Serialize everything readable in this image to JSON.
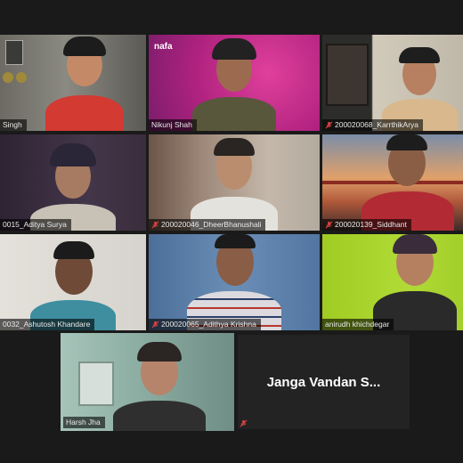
{
  "meeting": {
    "participants": [
      {
        "id": "p1",
        "label": "Singh",
        "muted": false,
        "bg": "#6f6d66",
        "shirt": "#d23a32",
        "skin": "#c48a67",
        "hat": "#1c1c1c"
      },
      {
        "id": "p2",
        "label": "Nikunj Shah",
        "muted": false,
        "bg": "#c0288f",
        "shirt": "#58573b",
        "skin": "#9c6b4f",
        "hat": "#222222"
      },
      {
        "id": "p3",
        "label": "200020068_KarrthikArya",
        "muted": true,
        "bg": "#c9c2b3",
        "shirt": "#d8b88c",
        "skin": "#b78060",
        "hat": "#1e1e1e"
      },
      {
        "id": "p4",
        "label": "0015_Aditya Surya",
        "muted": false,
        "bg": "#3b2a3e",
        "shirt": "#c7c1b6",
        "skin": "#a77b62",
        "hat": "#2a2637"
      },
      {
        "id": "p5",
        "label": "200020046_DheerBhanushali",
        "muted": true,
        "bg": "#8b7b6d",
        "shirt": "#e4e2dd",
        "skin": "#b98d6e",
        "hat": "#2a2522"
      },
      {
        "id": "p6",
        "label": "200020139_Siddhant",
        "muted": true,
        "bg": "#c98a5a",
        "shirt": "#b22b34",
        "skin": "#8a5e44",
        "hat": "#1d1d1d"
      },
      {
        "id": "p7",
        "label": "0032_Ashutosh Khandare",
        "muted": false,
        "bg": "#dedbd5",
        "shirt": "#3e8ea0",
        "skin": "#6f4a36",
        "hat": "#1b1b1b"
      },
      {
        "id": "p8",
        "label": "200020065_Adithya Krishna",
        "muted": true,
        "bg": "#5a7ea8",
        "shirt": "#dcdadf",
        "skin": "#8a5d46",
        "hat": "#1b1b1b"
      },
      {
        "id": "p9",
        "label": "anirudh khichdegar",
        "muted": false,
        "bg": "#a9d22b",
        "shirt": "#2a2a2a",
        "skin": "#b58060",
        "hat": "#3b2c3b"
      },
      {
        "id": "p10",
        "label": "Harsh Jha",
        "muted": false,
        "active": true,
        "bg": "#8fa9a1",
        "shirt": "#2f2f2f",
        "skin": "#b5846a",
        "hat": "#2b2523"
      }
    ],
    "name_only_tile": {
      "display_name": "Janga Vandan S...",
      "muted": true
    },
    "colors": {
      "active_speaker_border": "#b8d43a",
      "mic_off_red": "#e04343",
      "background": "#1a1a1a"
    },
    "icons": {
      "mic_off": "microphone-muted-icon"
    }
  }
}
